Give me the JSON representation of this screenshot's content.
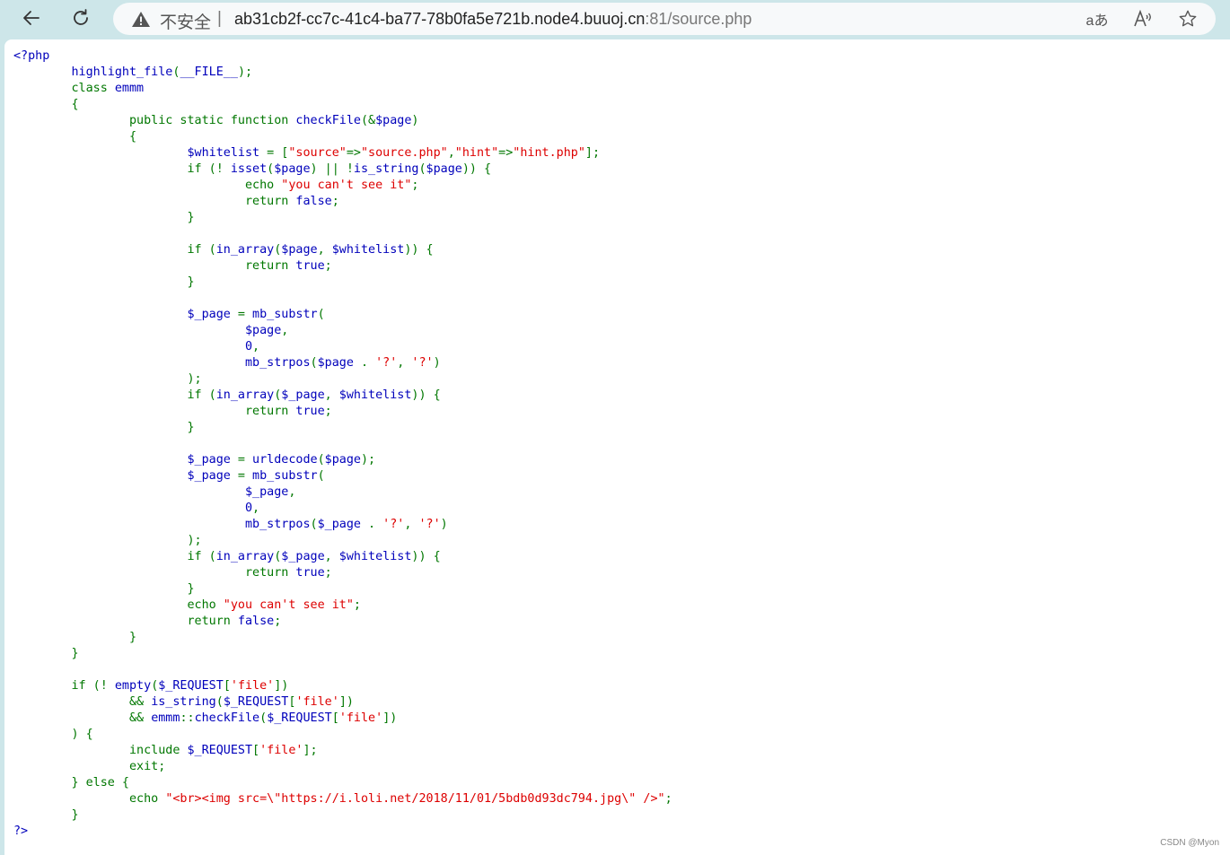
{
  "browser": {
    "insecure_label": "不安全",
    "separator": "|",
    "url_host": "ab31cb2f-cc7c-41c4-ba77-78b0fa5e721b.node4.buuoj.cn",
    "url_rest": ":81/source.php",
    "translate_icon": "aあ",
    "read_aloud_icon": "A))",
    "icons": [
      "back-icon",
      "refresh-icon",
      "warning-icon",
      "translate-icon",
      "read-aloud-icon",
      "favorite-star-icon"
    ]
  },
  "code_lines": [
    [
      [
        "html",
        "<?php"
      ]
    ],
    [
      [
        "default",
        "        highlight_file"
      ],
      [
        "kw",
        "("
      ],
      [
        "default",
        "__FILE__"
      ],
      [
        "kw",
        ");"
      ]
    ],
    [
      [
        "kw",
        "        class "
      ],
      [
        "default",
        "emmm"
      ]
    ],
    [
      [
        "kw",
        "        {"
      ]
    ],
    [
      [
        "kw",
        "                public static function "
      ],
      [
        "default",
        "checkFile"
      ],
      [
        "kw",
        "(&"
      ],
      [
        "default",
        "$page"
      ],
      [
        "kw",
        ")"
      ]
    ],
    [
      [
        "kw",
        "                {"
      ]
    ],
    [
      [
        "default",
        "                        $whitelist "
      ],
      [
        "kw",
        "= ["
      ],
      [
        "str",
        "\"source\""
      ],
      [
        "kw",
        "=>"
      ],
      [
        "str",
        "\"source.php\""
      ],
      [
        "kw",
        ","
      ],
      [
        "str",
        "\"hint\""
      ],
      [
        "kw",
        "=>"
      ],
      [
        "str",
        "\"hint.php\""
      ],
      [
        "kw",
        "];"
      ]
    ],
    [
      [
        "kw",
        "                        if (! "
      ],
      [
        "default",
        "isset"
      ],
      [
        "kw",
        "("
      ],
      [
        "default",
        "$page"
      ],
      [
        "kw",
        ") || !"
      ],
      [
        "default",
        "is_string"
      ],
      [
        "kw",
        "("
      ],
      [
        "default",
        "$page"
      ],
      [
        "kw",
        ")) {"
      ]
    ],
    [
      [
        "kw",
        "                                echo "
      ],
      [
        "str",
        "\"you can't see it\""
      ],
      [
        "kw",
        ";"
      ]
    ],
    [
      [
        "kw",
        "                                return "
      ],
      [
        "default",
        "false"
      ],
      [
        "kw",
        ";"
      ]
    ],
    [
      [
        "kw",
        "                        }"
      ]
    ],
    [
      [
        "kw",
        ""
      ]
    ],
    [
      [
        "kw",
        "                        if ("
      ],
      [
        "default",
        "in_array"
      ],
      [
        "kw",
        "("
      ],
      [
        "default",
        "$page"
      ],
      [
        "kw",
        ", "
      ],
      [
        "default",
        "$whitelist"
      ],
      [
        "kw",
        ")) {"
      ]
    ],
    [
      [
        "kw",
        "                                return "
      ],
      [
        "default",
        "true"
      ],
      [
        "kw",
        ";"
      ]
    ],
    [
      [
        "kw",
        "                        }"
      ]
    ],
    [
      [
        "kw",
        ""
      ]
    ],
    [
      [
        "default",
        "                        $_page "
      ],
      [
        "kw",
        "= "
      ],
      [
        "default",
        "mb_substr"
      ],
      [
        "kw",
        "("
      ]
    ],
    [
      [
        "default",
        "                                $page"
      ],
      [
        "kw",
        ","
      ]
    ],
    [
      [
        "default",
        "                                0"
      ],
      [
        "kw",
        ","
      ]
    ],
    [
      [
        "default",
        "                                mb_strpos"
      ],
      [
        "kw",
        "("
      ],
      [
        "default",
        "$page "
      ],
      [
        "kw",
        ". "
      ],
      [
        "str",
        "'?'"
      ],
      [
        "kw",
        ", "
      ],
      [
        "str",
        "'?'"
      ],
      [
        "kw",
        ")"
      ]
    ],
    [
      [
        "kw",
        "                        );"
      ]
    ],
    [
      [
        "kw",
        "                        if ("
      ],
      [
        "default",
        "in_array"
      ],
      [
        "kw",
        "("
      ],
      [
        "default",
        "$_page"
      ],
      [
        "kw",
        ", "
      ],
      [
        "default",
        "$whitelist"
      ],
      [
        "kw",
        ")) {"
      ]
    ],
    [
      [
        "kw",
        "                                return "
      ],
      [
        "default",
        "true"
      ],
      [
        "kw",
        ";"
      ]
    ],
    [
      [
        "kw",
        "                        }"
      ]
    ],
    [
      [
        "kw",
        ""
      ]
    ],
    [
      [
        "default",
        "                        $_page "
      ],
      [
        "kw",
        "= "
      ],
      [
        "default",
        "urldecode"
      ],
      [
        "kw",
        "("
      ],
      [
        "default",
        "$page"
      ],
      [
        "kw",
        ");"
      ]
    ],
    [
      [
        "default",
        "                        $_page "
      ],
      [
        "kw",
        "= "
      ],
      [
        "default",
        "mb_substr"
      ],
      [
        "kw",
        "("
      ]
    ],
    [
      [
        "default",
        "                                $_page"
      ],
      [
        "kw",
        ","
      ]
    ],
    [
      [
        "default",
        "                                0"
      ],
      [
        "kw",
        ","
      ]
    ],
    [
      [
        "default",
        "                                mb_strpos"
      ],
      [
        "kw",
        "("
      ],
      [
        "default",
        "$_page "
      ],
      [
        "kw",
        ". "
      ],
      [
        "str",
        "'?'"
      ],
      [
        "kw",
        ", "
      ],
      [
        "str",
        "'?'"
      ],
      [
        "kw",
        ")"
      ]
    ],
    [
      [
        "kw",
        "                        );"
      ]
    ],
    [
      [
        "kw",
        "                        if ("
      ],
      [
        "default",
        "in_array"
      ],
      [
        "kw",
        "("
      ],
      [
        "default",
        "$_page"
      ],
      [
        "kw",
        ", "
      ],
      [
        "default",
        "$whitelist"
      ],
      [
        "kw",
        ")) {"
      ]
    ],
    [
      [
        "kw",
        "                                return "
      ],
      [
        "default",
        "true"
      ],
      [
        "kw",
        ";"
      ]
    ],
    [
      [
        "kw",
        "                        }"
      ]
    ],
    [
      [
        "kw",
        "                        echo "
      ],
      [
        "str",
        "\"you can't see it\""
      ],
      [
        "kw",
        ";"
      ]
    ],
    [
      [
        "kw",
        "                        return "
      ],
      [
        "default",
        "false"
      ],
      [
        "kw",
        ";"
      ]
    ],
    [
      [
        "kw",
        "                }"
      ]
    ],
    [
      [
        "kw",
        "        }"
      ]
    ],
    [
      [
        "kw",
        ""
      ]
    ],
    [
      [
        "kw",
        "        if (! "
      ],
      [
        "default",
        "empty"
      ],
      [
        "kw",
        "("
      ],
      [
        "default",
        "$_REQUEST"
      ],
      [
        "kw",
        "["
      ],
      [
        "str",
        "'file'"
      ],
      [
        "kw",
        "])"
      ]
    ],
    [
      [
        "kw",
        "                && "
      ],
      [
        "default",
        "is_string"
      ],
      [
        "kw",
        "("
      ],
      [
        "default",
        "$_REQUEST"
      ],
      [
        "kw",
        "["
      ],
      [
        "str",
        "'file'"
      ],
      [
        "kw",
        "])"
      ]
    ],
    [
      [
        "kw",
        "                && "
      ],
      [
        "default",
        "emmm"
      ],
      [
        "kw",
        "::"
      ],
      [
        "default",
        "checkFile"
      ],
      [
        "kw",
        "("
      ],
      [
        "default",
        "$_REQUEST"
      ],
      [
        "kw",
        "["
      ],
      [
        "str",
        "'file'"
      ],
      [
        "kw",
        "])"
      ]
    ],
    [
      [
        "kw",
        "        ) {"
      ]
    ],
    [
      [
        "kw",
        "                include "
      ],
      [
        "default",
        "$_REQUEST"
      ],
      [
        "kw",
        "["
      ],
      [
        "str",
        "'file'"
      ],
      [
        "kw",
        "];"
      ]
    ],
    [
      [
        "kw",
        "                exit;"
      ]
    ],
    [
      [
        "kw",
        "        } else {"
      ]
    ],
    [
      [
        "kw",
        "                echo "
      ],
      [
        "str",
        "\"<br><img src=\\\"https://i.loli.net/2018/11/01/5bdb0d93dc794.jpg\\\" />\""
      ],
      [
        "kw",
        ";"
      ]
    ],
    [
      [
        "kw",
        "        }"
      ]
    ],
    [
      [
        "html",
        "?>"
      ]
    ]
  ],
  "footer": {
    "watermark": "CSDN @Myon⁠"
  }
}
